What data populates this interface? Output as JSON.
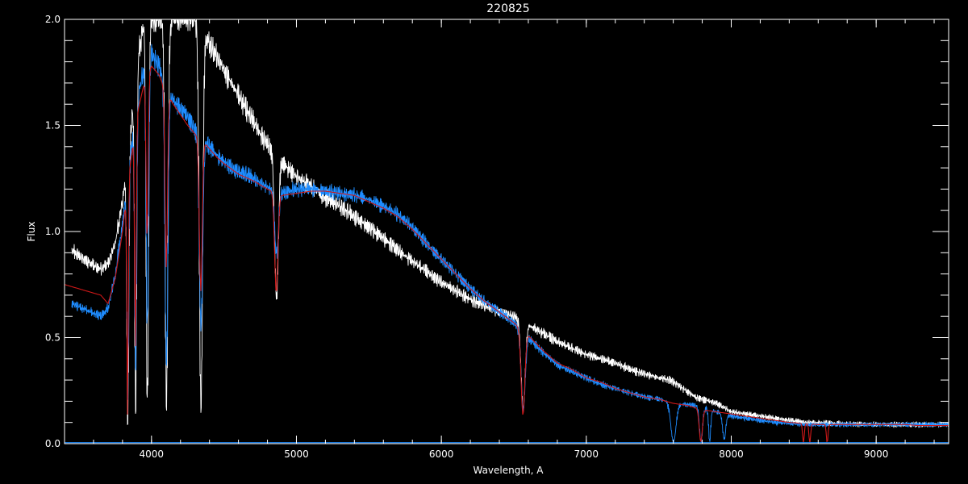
{
  "chart_data": {
    "type": "line",
    "title": "220825",
    "xlabel": "Wavelength, A",
    "ylabel": "Flux",
    "xlim": [
      3400,
      9500
    ],
    "ylim": [
      0,
      2.0
    ],
    "x_ticks": [
      4000,
      5000,
      6000,
      7000,
      8000,
      9000
    ],
    "y_ticks": [
      0.0,
      0.5,
      1.0,
      1.5,
      2.0
    ],
    "x_tick_labels": [
      "4000",
      "5000",
      "6000",
      "7000",
      "8000",
      "9000"
    ],
    "y_tick_labels": [
      "0.0",
      "0.5",
      "1.0",
      "1.5",
      "2.0"
    ],
    "x_minor_step": 200,
    "y_minor_step": 0.1,
    "grid": false,
    "legend": "none",
    "colors": {
      "background": "#000000",
      "axes": "#ffffff",
      "observed": "#ffffff",
      "calibrated": "#1e8cff",
      "model": "#d01818",
      "error": "#1e8cff"
    },
    "series": [
      {
        "color": "#ffffff",
        "x": [
          3450,
          3550,
          3650,
          3700,
          3750,
          3800,
          3850,
          3900,
          3950,
          4000,
          4050,
          4100,
          4150,
          4200,
          4250,
          4300,
          4350,
          4400,
          4450,
          4500,
          4550,
          4600,
          4650,
          4700,
          4750,
          4800,
          4850,
          4900,
          4950,
          5000,
          5100,
          5200,
          5300,
          5400,
          5500,
          5600,
          5700,
          5800,
          5900,
          6000,
          6100,
          6200,
          6300,
          6400,
          6500,
          6563,
          6600,
          6700,
          6800,
          6900,
          7000,
          7100,
          7200,
          7300,
          7400,
          7500,
          7580,
          7750,
          7800,
          7850,
          7900,
          7950,
          8000,
          8100,
          8200,
          8300,
          8400,
          8500,
          9000,
          9500
        ],
        "y": [
          0.91,
          0.86,
          0.82,
          0.85,
          0.95,
          1.15,
          1.45,
          1.8,
          2.0,
          2.0,
          2.0,
          2.0,
          2.0,
          2.0,
          2.0,
          2.0,
          1.95,
          1.88,
          1.82,
          1.76,
          1.7,
          1.64,
          1.58,
          1.52,
          1.46,
          1.41,
          1.37,
          1.33,
          1.29,
          1.26,
          1.21,
          1.16,
          1.12,
          1.07,
          1.02,
          0.97,
          0.91,
          0.86,
          0.81,
          0.76,
          0.72,
          0.68,
          0.65,
          0.62,
          0.6,
          0.58,
          0.56,
          0.52,
          0.48,
          0.45,
          0.42,
          0.4,
          0.38,
          0.35,
          0.33,
          0.31,
          0.3,
          0.22,
          0.21,
          0.2,
          0.19,
          0.17,
          0.15,
          0.14,
          0.13,
          0.12,
          0.11,
          0.1,
          0.09,
          0.09
        ],
        "noise": 0.03,
        "absorption": [
          [
            3835,
            0.06,
            10
          ],
          [
            3889,
            0.08,
            10
          ],
          [
            3970,
            0.08,
            12
          ],
          [
            4102,
            0.08,
            14
          ],
          [
            4340,
            0.08,
            16
          ],
          [
            4861,
            0.5,
            18
          ],
          [
            6563,
            0.28,
            20
          ]
        ]
      },
      {
        "color": "#1e8cff",
        "x": [
          3450,
          3550,
          3650,
          3700,
          3750,
          3800,
          3850,
          3900,
          3950,
          4000,
          4050,
          4100,
          4150,
          4200,
          4250,
          4300,
          4350,
          4400,
          4450,
          4500,
          4550,
          4600,
          4650,
          4700,
          4750,
          4800,
          4850,
          4900,
          4950,
          5000,
          5100,
          5200,
          5300,
          5400,
          5500,
          5600,
          5700,
          5800,
          5900,
          6000,
          6100,
          6200,
          6300,
          6400,
          6500,
          6563,
          6600,
          6700,
          6800,
          6900,
          7000,
          7100,
          7200,
          7300,
          7400,
          7500,
          7600,
          7750,
          7800,
          7850,
          7900,
          7950,
          8000,
          8100,
          8200,
          8300,
          8400,
          8500,
          8600,
          8700,
          8800,
          8900,
          9000,
          9100,
          9200,
          9300,
          9400,
          9500
        ],
        "y": [
          0.66,
          0.63,
          0.6,
          0.64,
          0.8,
          1.05,
          1.35,
          1.62,
          1.78,
          1.84,
          1.78,
          1.68,
          1.62,
          1.58,
          1.54,
          1.48,
          1.44,
          1.4,
          1.36,
          1.33,
          1.3,
          1.28,
          1.27,
          1.25,
          1.23,
          1.21,
          1.19,
          1.18,
          1.19,
          1.2,
          1.2,
          1.19,
          1.18,
          1.17,
          1.15,
          1.12,
          1.08,
          1.02,
          0.94,
          0.87,
          0.8,
          0.73,
          0.67,
          0.62,
          0.57,
          0.53,
          0.5,
          0.43,
          0.37,
          0.34,
          0.31,
          0.28,
          0.26,
          0.24,
          0.22,
          0.21,
          0.19,
          0.18,
          0.17,
          0.16,
          0.15,
          0.14,
          0.13,
          0.12,
          0.11,
          0.1,
          0.095,
          0.09,
          0.09,
          0.09,
          0.09,
          0.09,
          0.09,
          0.09,
          0.09,
          0.09,
          0.09,
          0.09
        ],
        "noise": 0.025,
        "absorption": [
          [
            3835,
            0.16,
            9
          ],
          [
            3889,
            0.22,
            10
          ],
          [
            3970,
            0.3,
            12
          ],
          [
            4102,
            0.22,
            14
          ],
          [
            4340,
            0.38,
            16
          ],
          [
            4861,
            0.75,
            18
          ],
          [
            6563,
            0.3,
            20
          ],
          [
            7600,
            0.05,
            25
          ],
          [
            7790,
            0.06,
            15
          ],
          [
            7850,
            0.06,
            10
          ],
          [
            7950,
            0.15,
            15
          ]
        ]
      },
      {
        "color": "#d01818",
        "x": [
          3400,
          3500,
          3600,
          3650,
          3700,
          3750,
          3800,
          3850,
          3900,
          3950,
          4000,
          4050,
          4100,
          4150,
          4200,
          4250,
          4300,
          4350,
          4400,
          4450,
          4500,
          4600,
          4700,
          4800,
          4900,
          5000,
          5100,
          5200,
          5300,
          5400,
          5500,
          5600,
          5700,
          5800,
          5900,
          6000,
          6100,
          6200,
          6300,
          6400,
          6500,
          6600,
          6700,
          6800,
          6900,
          7000,
          7100,
          7200,
          7300,
          7400,
          7500,
          7600,
          7700,
          7800,
          7900,
          8000,
          8100,
          8200,
          8300,
          8400,
          8500,
          8600,
          8700,
          8800,
          8900,
          9000,
          9100,
          9200,
          9300,
          9400,
          9500
        ],
        "y": [
          0.75,
          0.73,
          0.71,
          0.7,
          0.66,
          0.78,
          1.0,
          1.3,
          1.55,
          1.7,
          1.78,
          1.74,
          1.66,
          1.6,
          1.55,
          1.5,
          1.46,
          1.43,
          1.39,
          1.35,
          1.32,
          1.27,
          1.24,
          1.2,
          1.17,
          1.18,
          1.19,
          1.19,
          1.18,
          1.17,
          1.14,
          1.11,
          1.07,
          1.01,
          0.94,
          0.87,
          0.8,
          0.73,
          0.67,
          0.62,
          0.57,
          0.51,
          0.44,
          0.38,
          0.35,
          0.31,
          0.29,
          0.26,
          0.24,
          0.22,
          0.21,
          0.19,
          0.18,
          0.16,
          0.15,
          0.14,
          0.13,
          0.12,
          0.11,
          0.1,
          0.095,
          0.09,
          0.09,
          0.09,
          0.09,
          0.09,
          0.09,
          0.09,
          0.085,
          0.085,
          0.085
        ],
        "absorption": [
          [
            3835,
            0.1,
            7
          ],
          [
            3889,
            0.3,
            8
          ],
          [
            3970,
            0.55,
            10
          ],
          [
            4102,
            0.5,
            12
          ],
          [
            4340,
            0.5,
            14
          ],
          [
            4861,
            0.6,
            16
          ],
          [
            6563,
            0.25,
            18
          ],
          [
            7790,
            0.05,
            15
          ],
          [
            8498,
            0.02,
            8
          ],
          [
            8542,
            0.02,
            8
          ],
          [
            8662,
            0.02,
            8
          ]
        ]
      },
      {
        "color": "#1e8cff",
        "x": [
          3400,
          5000,
          9500
        ],
        "y": [
          0.005,
          0.005,
          0.005
        ]
      }
    ]
  }
}
